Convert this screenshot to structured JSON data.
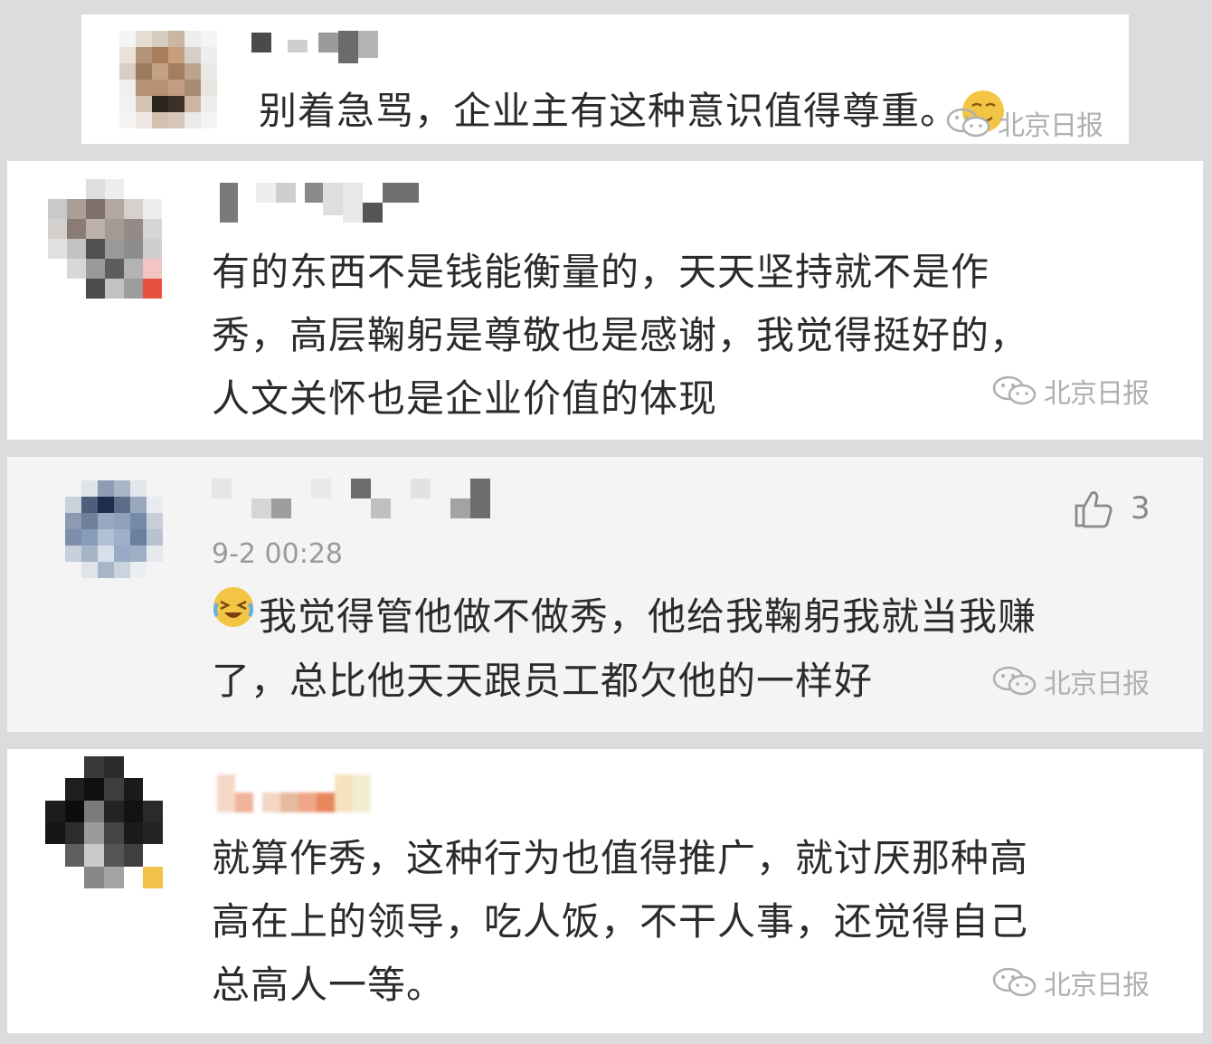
{
  "comments": [
    {
      "lines": [
        "别着急骂，企业主有这种意识值得尊重。"
      ],
      "watermark": "北京日报"
    },
    {
      "lines": [
        "有的东西不是钱能衡量的，天天坚持就不是作",
        "秀，高层鞠躬是尊敬也是感谢，我觉得挺好的，",
        "人文关怀也是企业价值的体现"
      ],
      "watermark": "北京日报"
    },
    {
      "date": "9-2 00:28",
      "likes": "3",
      "lines": [
        "我觉得管他做不做秀，他给我鞠躬我就当我赚",
        "了，总比他天天跟员工都欠他的一样好"
      ],
      "watermark": "北京日报"
    },
    {
      "lines": [
        "就算作秀，这种行为也值得推广，就讨厌那种高",
        "高在上的领导，吃人饭，不干人事，还觉得自己",
        "总高人一等。"
      ],
      "watermark": "北京日报"
    }
  ],
  "icons": {
    "wechat": "wechat-icon",
    "thumb": "thumbs-up-icon",
    "smile_emoji": "smile-emoji-icon",
    "laugh_emoji": "laughing-crying-emoji-icon"
  },
  "colors": {
    "text": "#2b2b2b",
    "watermark": "#b0b0b0",
    "meta": "#9a9a9a",
    "card": "#ffffff",
    "card_gray": "#f4f4f4",
    "background": "#dcdcdc"
  }
}
